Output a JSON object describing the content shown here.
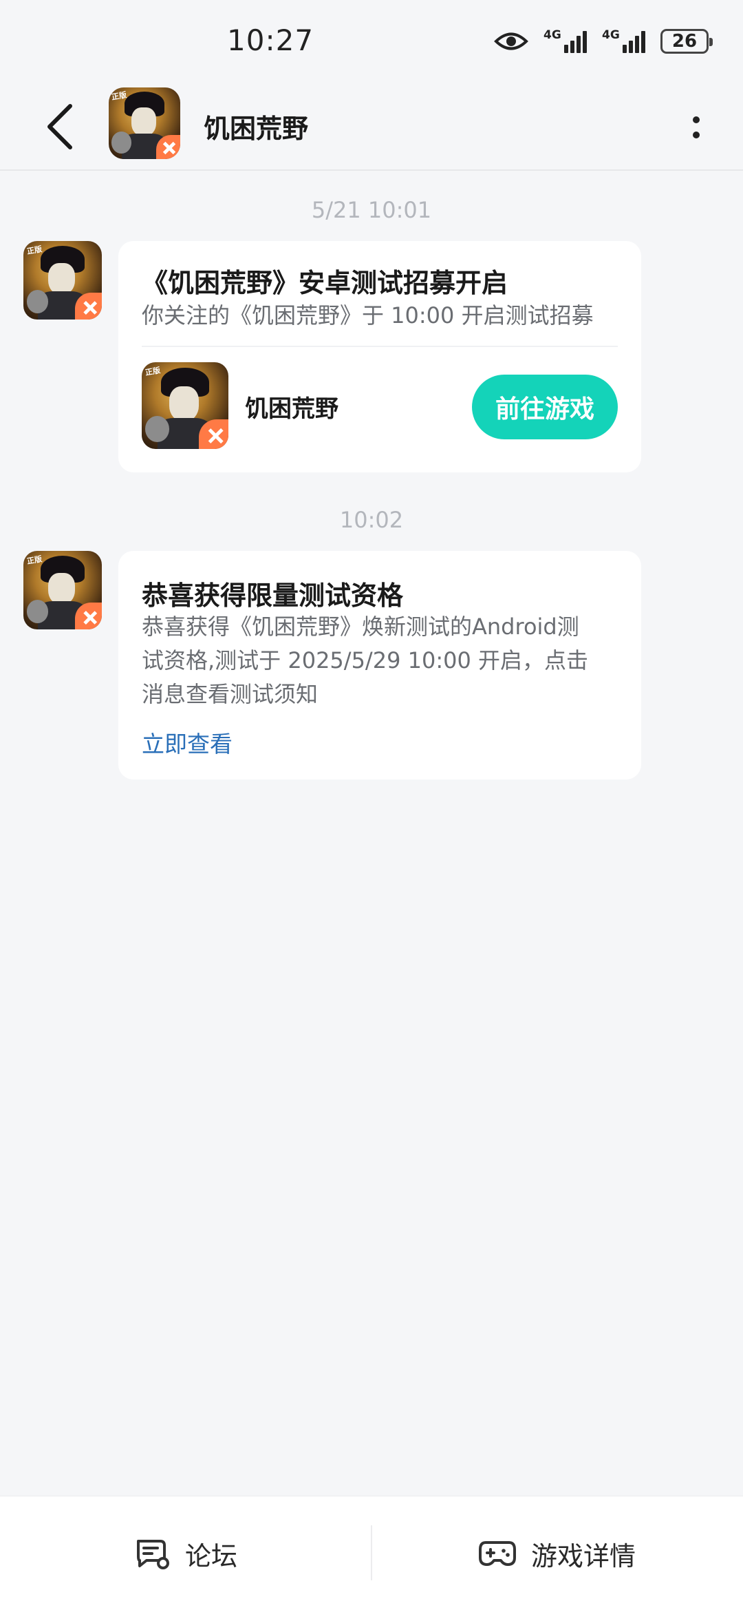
{
  "status_bar": {
    "time": "10:27",
    "network1": "4G",
    "network2": "4G",
    "battery": "26"
  },
  "header": {
    "title": "饥困荒野",
    "back_icon": "chevron-left-icon",
    "more_icon": "more-vertical-icon"
  },
  "messages": [
    {
      "timestamp": "5/21  10:01",
      "title": "《饥困荒野》安卓测试招募开启",
      "text": "你关注的《饥困荒野》于 10:00 开启测试招募",
      "game_name": "饥困荒野",
      "button_label": "前往游戏"
    },
    {
      "timestamp": "10:02",
      "title": "恭喜获得限量测试资格",
      "text_lines": [
        "恭喜获得《饥困荒野》焕新测试的Android测",
        "试资格,测试于 2025/5/29 10:00 开启，点击",
        "消息查看测试须知"
      ],
      "link_label": "立即查看"
    }
  ],
  "bottom_bar": {
    "forum_label": "论坛",
    "game_detail_label": "游戏详情"
  },
  "colors": {
    "accent": "#14d3b9",
    "link": "#2a6fb8",
    "background": "#f5f6f8"
  }
}
